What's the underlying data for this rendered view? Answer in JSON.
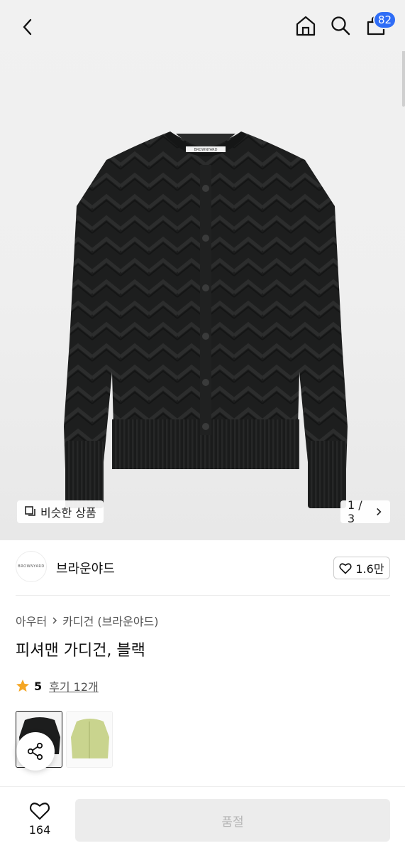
{
  "header": {
    "cart_count": "82",
    "icons": [
      "back-icon",
      "home-icon",
      "search-icon",
      "shopping-bag-icon"
    ]
  },
  "gallery": {
    "similar_label": "비슷한 상품",
    "page_indicator": "1 / 3",
    "garment_tag": "BROWNYARD"
  },
  "brand": {
    "logo_text": "BROWNYARD",
    "name": "브라운야드",
    "likes": "1.6만"
  },
  "product": {
    "breadcrumb": [
      "아우터",
      "카디건 (브라운야드)"
    ],
    "title": "피셔맨 가디건, 블랙",
    "rating": "5",
    "reviews": "후기 12개"
  },
  "colors": {
    "accent": "#2f6df6",
    "star": "#f5a623",
    "thumb_1": "#1c1d1d",
    "thumb_2": "#c9d48e"
  },
  "bottom_bar": {
    "wish_count": "164",
    "soldout_label": "품절"
  }
}
